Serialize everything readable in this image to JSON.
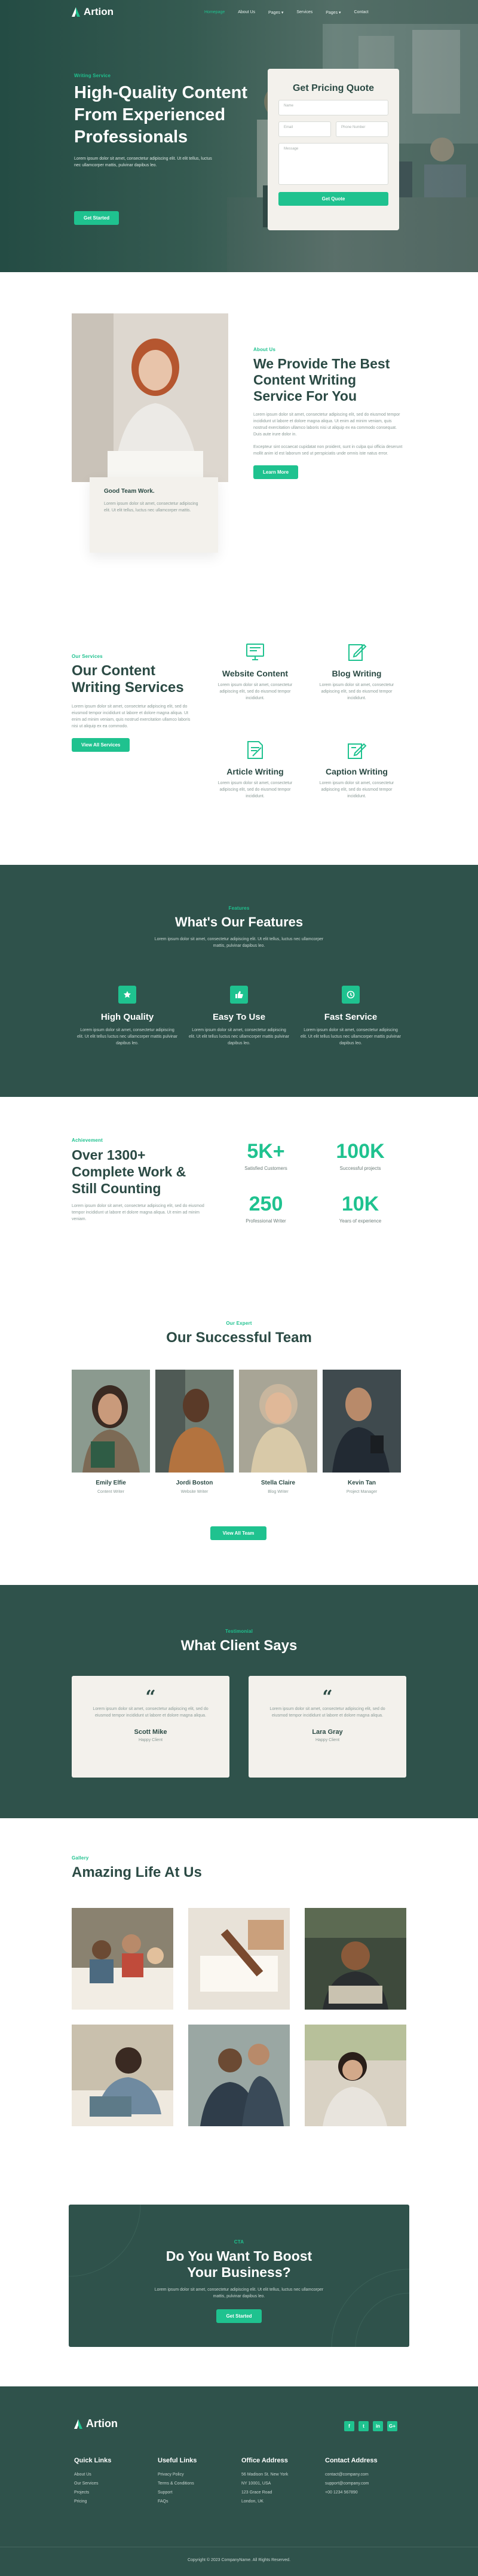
{
  "brand": {
    "name": "Artion",
    "accent": "#1fc28f",
    "dark": "#2f524b"
  },
  "nav": {
    "items": [
      "Homepage",
      "About Us",
      "Pages",
      "Services",
      "Pages",
      "Contact"
    ]
  },
  "hero": {
    "kicker": "Writing Service",
    "title": "High-Quality Content From Experienced Professionals",
    "subtitle": "Lorem ipsum dolor sit amet, consectetur adipiscing elit. Ut elit tellus, luctus nec ullamcorper mattis, pulvinar dapibus leo.",
    "button": "Get Started"
  },
  "quote": {
    "title": "Get Pricing Quote",
    "name_ph": "Name",
    "email_ph": "Email",
    "phone_ph": "Phone Number",
    "message_ph": "Message",
    "button": "Get Quote"
  },
  "about": {
    "card_title": "Good Team Work.",
    "card_text": "Lorem ipsum dolor sit amet, consectetur adipiscing elit. Ut elit tellus, luctus nec ullamcorper mattis.",
    "kicker": "About Us",
    "title": "We Provide The Best Content Writing Service For You",
    "p1": "Lorem ipsum dolor sit amet, consectetur adipiscing elit, sed do eiusmod tempor incididunt ut labore et dolore magna aliqua. Ut enim ad minim veniam, quis nostrud exercitation ullamco laboris nisi ut aliquip ex ea commodo consequat. Duis aute irure dolor in.",
    "p2": "Excepteur sint occaecat cupidatat non proident, sunt in culpa qui officia deserunt mollit anim id est laborum sed ut perspiciatis unde omnis iste natus error.",
    "button": "Learn More"
  },
  "services": {
    "kicker": "Our Services",
    "title": "Our Content Writing Services",
    "text": "Lorem ipsum dolor sit amet, consectetur adipiscing elit, sed do eiusmod tempor incididunt ut labore et dolore magna aliqua. Ut enim ad minim veniam, quis nostrud exercitation ullamco laboris nisi ut aliquip ex ea commodo.",
    "button": "View All Services",
    "items": [
      {
        "title": "Website Content",
        "text": "Lorem ipsum dolor sit amet, consectetur adipiscing elit, sed do eiusmod tempor incididunt."
      },
      {
        "title": "Blog Writing",
        "text": "Lorem ipsum dolor sit amet, consectetur adipiscing elit, sed do eiusmod tempor incididunt."
      },
      {
        "title": "Article Writing",
        "text": "Lorem ipsum dolor sit amet, consectetur adipiscing elit, sed do eiusmod tempor incididunt."
      },
      {
        "title": "Caption Writing",
        "text": "Lorem ipsum dolor sit amet, consectetur adipiscing elit, sed do eiusmod tempor incididunt."
      }
    ]
  },
  "features": {
    "kicker": "Features",
    "title": "What's Our Features",
    "text": "Lorem ipsum dolor sit amet, consectetur adipiscing elit. Ut elit tellus, luctus nec ullamcorper mattis, pulvinar dapibus leo.",
    "items": [
      {
        "title": "High Quality",
        "text": "Lorem ipsum dolor sit amet, consectetur adipiscing elit. Ut elit tellus luctus nec ullamcorper mattis pulvinar dapibus leo."
      },
      {
        "title": "Easy To Use",
        "text": "Lorem ipsum dolor sit amet, consectetur adipiscing elit. Ut elit tellus luctus nec ullamcorper mattis pulvinar dapibus leo."
      },
      {
        "title": "Fast Service",
        "text": "Lorem ipsum dolor sit amet, consectetur adipiscing elit. Ut elit tellus luctus nec ullamcorper mattis pulvinar dapibus leo."
      }
    ]
  },
  "stats": {
    "kicker": "Achievement",
    "title": "Over 1300+ Complete Work & Still Counting",
    "text": "Lorem ipsum dolor sit amet, consectetur adipiscing elit, sed do eiusmod tempor incididunt ut labore et dolore magna aliqua. Ut enim ad minim veniam.",
    "items": [
      {
        "num": "5K+",
        "label": "Satisfied Customers"
      },
      {
        "num": "100K",
        "label": "Successful projects"
      },
      {
        "num": "250",
        "label": "Professional Writer"
      },
      {
        "num": "10K",
        "label": "Years of experience"
      }
    ]
  },
  "team": {
    "kicker": "Our Expert",
    "title": "Our Successful Team",
    "button": "View All Team",
    "members": [
      {
        "name": "Emily Elfie",
        "role": "Content Writer"
      },
      {
        "name": "Jordi Boston",
        "role": "Website Writer"
      },
      {
        "name": "Stella Claire",
        "role": "Blog Writer"
      },
      {
        "name": "Kevin Tan",
        "role": "Project Manager"
      }
    ]
  },
  "testimonials": {
    "kicker": "Testimonial",
    "title": "What Client Says",
    "items": [
      {
        "text": "Lorem ipsum dolor sit amet, consectetur adipiscing elit, sed do eiusmod tempor incididunt ut labore et dolore magna aliqua.",
        "name": "Scott Mike",
        "role": "Happy Client"
      },
      {
        "text": "Lorem ipsum dolor sit amet, consectetur adipiscing elit, sed do eiusmod tempor incididunt ut labore et dolore magna aliqua.",
        "name": "Lara Gray",
        "role": "Happy Client"
      }
    ]
  },
  "gallery": {
    "kicker": "Gallery",
    "title": "Amazing Life At Us"
  },
  "cta": {
    "kicker": "CTA",
    "title": "Do You Want To Boost Your Business?",
    "text": "Lorem ipsum dolor sit amet, consectetur adipiscing elit. Ut elit tellus, luctus nec ullamcorper mattis, pulvinar dapibus leo.",
    "button": "Get Started"
  },
  "footer": {
    "social": [
      "f",
      "t",
      "in",
      "G+"
    ],
    "cols": [
      {
        "title": "Quick Links",
        "links": [
          "About Us",
          "Our Services",
          "Projects",
          "Pricing"
        ]
      },
      {
        "title": "Useful Links",
        "links": [
          "Privacy Policy",
          "Terms & Conditions",
          "Support",
          "FAQs"
        ]
      },
      {
        "title": "Office Address",
        "links": [
          "56 Madison St. New York",
          "NY 10001, USA",
          "",
          "123 Grace Road",
          "London, UK"
        ]
      },
      {
        "title": "Contact Address",
        "links": [
          "contact@company.com",
          "support@company.com",
          "+00 1234 567890"
        ]
      }
    ],
    "copyright": "Copyright © 2023 CompanyName. All Rights Reserved."
  }
}
